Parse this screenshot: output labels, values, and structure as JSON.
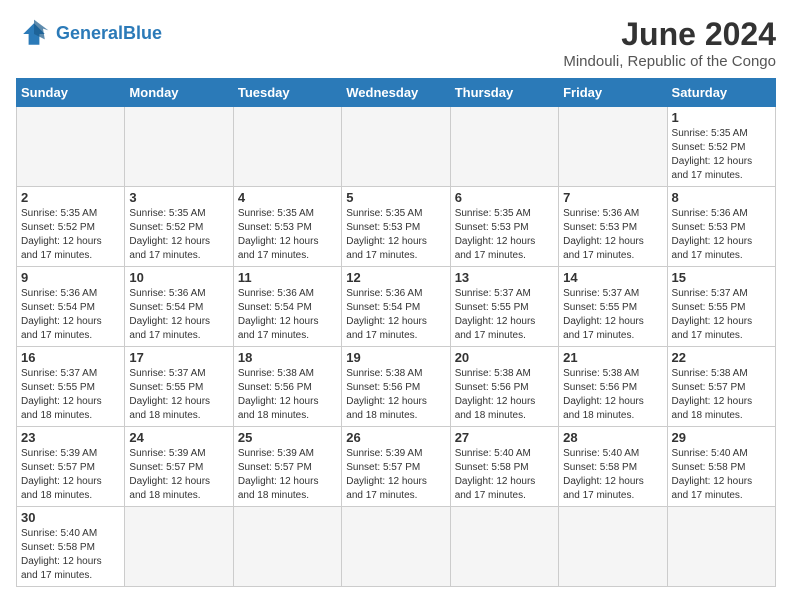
{
  "header": {
    "logo_general": "General",
    "logo_blue": "Blue",
    "month_title": "June 2024",
    "location": "Mindouli, Republic of the Congo"
  },
  "weekdays": [
    "Sunday",
    "Monday",
    "Tuesday",
    "Wednesday",
    "Thursday",
    "Friday",
    "Saturday"
  ],
  "weeks": [
    [
      {
        "day": "",
        "empty": true
      },
      {
        "day": "",
        "empty": true
      },
      {
        "day": "",
        "empty": true
      },
      {
        "day": "",
        "empty": true
      },
      {
        "day": "",
        "empty": true
      },
      {
        "day": "",
        "empty": true
      },
      {
        "day": "1",
        "sunrise": "Sunrise: 5:35 AM",
        "sunset": "Sunset: 5:52 PM",
        "daylight": "Daylight: 12 hours and 17 minutes."
      }
    ],
    [
      {
        "day": "2",
        "sunrise": "Sunrise: 5:35 AM",
        "sunset": "Sunset: 5:52 PM",
        "daylight": "Daylight: 12 hours and 17 minutes."
      },
      {
        "day": "3",
        "sunrise": "Sunrise: 5:35 AM",
        "sunset": "Sunset: 5:52 PM",
        "daylight": "Daylight: 12 hours and 17 minutes."
      },
      {
        "day": "4",
        "sunrise": "Sunrise: 5:35 AM",
        "sunset": "Sunset: 5:53 PM",
        "daylight": "Daylight: 12 hours and 17 minutes."
      },
      {
        "day": "5",
        "sunrise": "Sunrise: 5:35 AM",
        "sunset": "Sunset: 5:53 PM",
        "daylight": "Daylight: 12 hours and 17 minutes."
      },
      {
        "day": "6",
        "sunrise": "Sunrise: 5:35 AM",
        "sunset": "Sunset: 5:53 PM",
        "daylight": "Daylight: 12 hours and 17 minutes."
      },
      {
        "day": "7",
        "sunrise": "Sunrise: 5:36 AM",
        "sunset": "Sunset: 5:53 PM",
        "daylight": "Daylight: 12 hours and 17 minutes."
      },
      {
        "day": "8",
        "sunrise": "Sunrise: 5:36 AM",
        "sunset": "Sunset: 5:53 PM",
        "daylight": "Daylight: 12 hours and 17 minutes."
      }
    ],
    [
      {
        "day": "9",
        "sunrise": "Sunrise: 5:36 AM",
        "sunset": "Sunset: 5:54 PM",
        "daylight": "Daylight: 12 hours and 17 minutes."
      },
      {
        "day": "10",
        "sunrise": "Sunrise: 5:36 AM",
        "sunset": "Sunset: 5:54 PM",
        "daylight": "Daylight: 12 hours and 17 minutes."
      },
      {
        "day": "11",
        "sunrise": "Sunrise: 5:36 AM",
        "sunset": "Sunset: 5:54 PM",
        "daylight": "Daylight: 12 hours and 17 minutes."
      },
      {
        "day": "12",
        "sunrise": "Sunrise: 5:36 AM",
        "sunset": "Sunset: 5:54 PM",
        "daylight": "Daylight: 12 hours and 17 minutes."
      },
      {
        "day": "13",
        "sunrise": "Sunrise: 5:37 AM",
        "sunset": "Sunset: 5:55 PM",
        "daylight": "Daylight: 12 hours and 17 minutes."
      },
      {
        "day": "14",
        "sunrise": "Sunrise: 5:37 AM",
        "sunset": "Sunset: 5:55 PM",
        "daylight": "Daylight: 12 hours and 17 minutes."
      },
      {
        "day": "15",
        "sunrise": "Sunrise: 5:37 AM",
        "sunset": "Sunset: 5:55 PM",
        "daylight": "Daylight: 12 hours and 17 minutes."
      }
    ],
    [
      {
        "day": "16",
        "sunrise": "Sunrise: 5:37 AM",
        "sunset": "Sunset: 5:55 PM",
        "daylight": "Daylight: 12 hours and 18 minutes."
      },
      {
        "day": "17",
        "sunrise": "Sunrise: 5:37 AM",
        "sunset": "Sunset: 5:55 PM",
        "daylight": "Daylight: 12 hours and 18 minutes."
      },
      {
        "day": "18",
        "sunrise": "Sunrise: 5:38 AM",
        "sunset": "Sunset: 5:56 PM",
        "daylight": "Daylight: 12 hours and 18 minutes."
      },
      {
        "day": "19",
        "sunrise": "Sunrise: 5:38 AM",
        "sunset": "Sunset: 5:56 PM",
        "daylight": "Daylight: 12 hours and 18 minutes."
      },
      {
        "day": "20",
        "sunrise": "Sunrise: 5:38 AM",
        "sunset": "Sunset: 5:56 PM",
        "daylight": "Daylight: 12 hours and 18 minutes."
      },
      {
        "day": "21",
        "sunrise": "Sunrise: 5:38 AM",
        "sunset": "Sunset: 5:56 PM",
        "daylight": "Daylight: 12 hours and 18 minutes."
      },
      {
        "day": "22",
        "sunrise": "Sunrise: 5:38 AM",
        "sunset": "Sunset: 5:57 PM",
        "daylight": "Daylight: 12 hours and 18 minutes."
      }
    ],
    [
      {
        "day": "23",
        "sunrise": "Sunrise: 5:39 AM",
        "sunset": "Sunset: 5:57 PM",
        "daylight": "Daylight: 12 hours and 18 minutes."
      },
      {
        "day": "24",
        "sunrise": "Sunrise: 5:39 AM",
        "sunset": "Sunset: 5:57 PM",
        "daylight": "Daylight: 12 hours and 18 minutes."
      },
      {
        "day": "25",
        "sunrise": "Sunrise: 5:39 AM",
        "sunset": "Sunset: 5:57 PM",
        "daylight": "Daylight: 12 hours and 18 minutes."
      },
      {
        "day": "26",
        "sunrise": "Sunrise: 5:39 AM",
        "sunset": "Sunset: 5:57 PM",
        "daylight": "Daylight: 12 hours and 17 minutes."
      },
      {
        "day": "27",
        "sunrise": "Sunrise: 5:40 AM",
        "sunset": "Sunset: 5:58 PM",
        "daylight": "Daylight: 12 hours and 17 minutes."
      },
      {
        "day": "28",
        "sunrise": "Sunrise: 5:40 AM",
        "sunset": "Sunset: 5:58 PM",
        "daylight": "Daylight: 12 hours and 17 minutes."
      },
      {
        "day": "29",
        "sunrise": "Sunrise: 5:40 AM",
        "sunset": "Sunset: 5:58 PM",
        "daylight": "Daylight: 12 hours and 17 minutes."
      }
    ],
    [
      {
        "day": "30",
        "sunrise": "Sunrise: 5:40 AM",
        "sunset": "Sunset: 5:58 PM",
        "daylight": "Daylight: 12 hours and 17 minutes."
      },
      {
        "day": "",
        "empty": true
      },
      {
        "day": "",
        "empty": true
      },
      {
        "day": "",
        "empty": true
      },
      {
        "day": "",
        "empty": true
      },
      {
        "day": "",
        "empty": true
      },
      {
        "day": "",
        "empty": true
      }
    ]
  ]
}
